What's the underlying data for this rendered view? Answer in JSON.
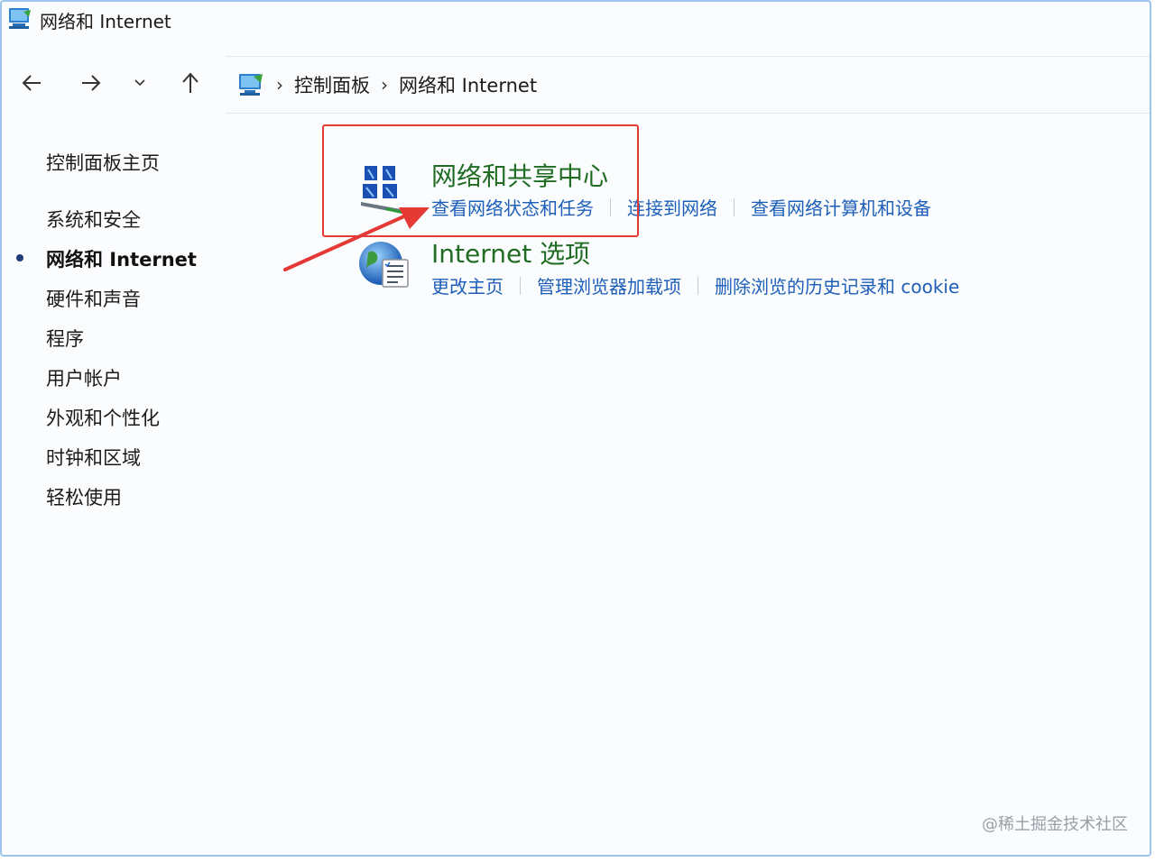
{
  "window": {
    "title": "网络和 Internet"
  },
  "nav": {
    "back_icon": "arrow-left-icon",
    "forward_icon": "arrow-right-icon",
    "recent_icon": "chevron-down-icon",
    "up_icon": "arrow-up-icon"
  },
  "breadcrumb": {
    "items": [
      "控制面板",
      "网络和 Internet"
    ],
    "separator": "›"
  },
  "sidebar": {
    "items": [
      {
        "label": "控制面板主页",
        "active": false
      },
      {
        "label": "系统和安全",
        "active": false
      },
      {
        "label": "网络和 Internet",
        "active": true
      },
      {
        "label": "硬件和声音",
        "active": false
      },
      {
        "label": "程序",
        "active": false
      },
      {
        "label": "用户帐户",
        "active": false
      },
      {
        "label": "外观和个性化",
        "active": false
      },
      {
        "label": "时钟和区域",
        "active": false
      },
      {
        "label": "轻松使用",
        "active": false
      }
    ]
  },
  "categories": [
    {
      "title": "网络和共享中心",
      "icon": "network-sharing-center-icon",
      "links": [
        "查看网络状态和任务",
        "连接到网络",
        "查看网络计算机和设备"
      ]
    },
    {
      "title": "Internet 选项",
      "icon": "internet-options-globe-icon",
      "links": [
        "更改主页",
        "管理浏览器加载项",
        "删除浏览的历史记录和 cookie"
      ]
    }
  ],
  "annotation": {
    "highlight_color": "#e53935"
  },
  "watermark": "@稀土掘金技术社区"
}
